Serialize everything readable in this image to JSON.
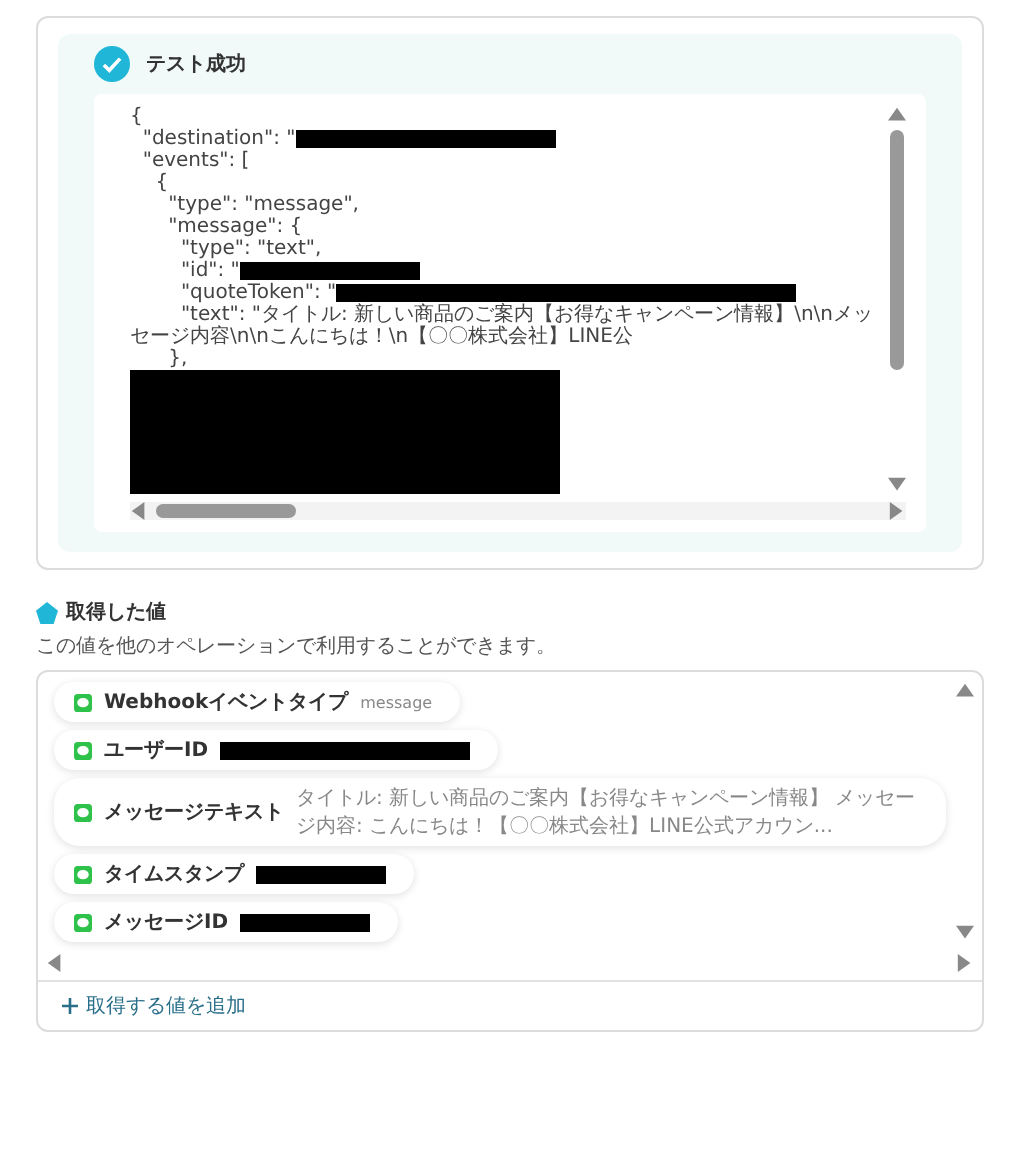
{
  "test_result": {
    "title": "テスト成功"
  },
  "code": {
    "lines": [
      {
        "text": "{",
        "redacted": false
      },
      {
        "text": "  \"destination\": \"",
        "redacted": true
      },
      {
        "text": "  \"events\": [",
        "redacted": false
      },
      {
        "text": "    {",
        "redacted": false
      },
      {
        "text": "      \"type\": \"message\",",
        "redacted": false
      },
      {
        "text": "      \"message\": {",
        "redacted": false
      },
      {
        "text": "        \"type\": \"text\",",
        "redacted": false
      },
      {
        "text": "        \"id\": \"",
        "redacted": true
      },
      {
        "text": "        \"quoteToken\": \"",
        "redacted": true
      },
      {
        "text": "        \"text\": \"タイトル: 新しい商品のご案内【お得なキャンペーン情報】\\n\\nメッセージ内容\\n\\nこんにちは！\\n【〇〇株式会社】LINE公",
        "redacted": false
      },
      {
        "text": "      },",
        "redacted": false
      }
    ],
    "redacted_block": true
  },
  "output": {
    "title": "取得した値",
    "description": "この値を他のオペレーションで利用することができます。",
    "items": [
      {
        "label": "Webhookイベントタイプ",
        "value": "message",
        "redacted": false
      },
      {
        "label": "ユーザーID",
        "redacted": true
      },
      {
        "label": "メッセージテキスト",
        "value": "タイトル: 新しい商品のご案内【お得なキャンペーン情報】 メッセージ内容: こんにちは！【〇〇株式会社】LINE公式アカウン...",
        "redacted": false
      },
      {
        "label": "タイムスタンプ",
        "redacted": true
      },
      {
        "label": "メッセージID",
        "redacted": true
      }
    ],
    "add_link": "取得する値を追加"
  }
}
